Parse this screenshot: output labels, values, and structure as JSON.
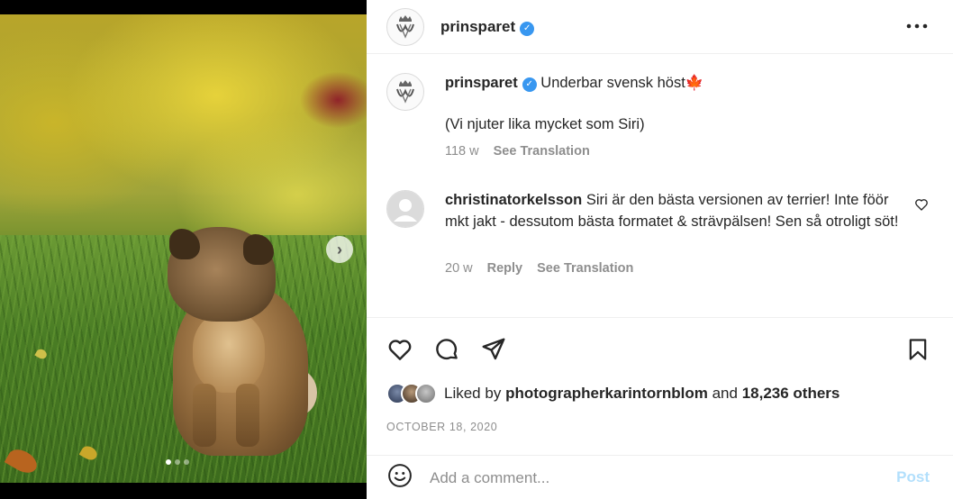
{
  "post": {
    "username": "prinsparet",
    "verified_icon": "verified-badge-icon",
    "more_icon": "more-options-icon"
  },
  "caption": {
    "username": "prinsparet",
    "text_line1": "Underbar svensk höst🍁",
    "text_line2": "(Vi njuter lika mycket som Siri)",
    "age": "118 w",
    "translate": "See Translation"
  },
  "comment1": {
    "username": "christinatorkelsson",
    "text": "Siri är den bästa versionen av terrier! Inte föör mkt jakt - dessutom bästa formatet & strävpälsen! Sen så otroligt söt!",
    "age": "20 w",
    "reply": "Reply",
    "translate": "See Translation"
  },
  "actions": {
    "like_icon": "heart-icon",
    "comment_icon": "comment-icon",
    "share_icon": "send-icon",
    "save_icon": "bookmark-icon"
  },
  "likes": {
    "prefix": "Liked by",
    "user": "photographerkarintornblom",
    "and": "and",
    "others": "18,236 others"
  },
  "date": "OCTOBER 18, 2020",
  "add_comment": {
    "placeholder": "Add a comment...",
    "post_label": "Post",
    "emoji_icon": "emoji-icon"
  },
  "carousel": {
    "slide_count": 3,
    "active_slide": 1
  },
  "colors": {
    "verified": "#3897f0",
    "post_button_disabled": "#b2dffc",
    "secondary_text": "#8e8e8e"
  }
}
